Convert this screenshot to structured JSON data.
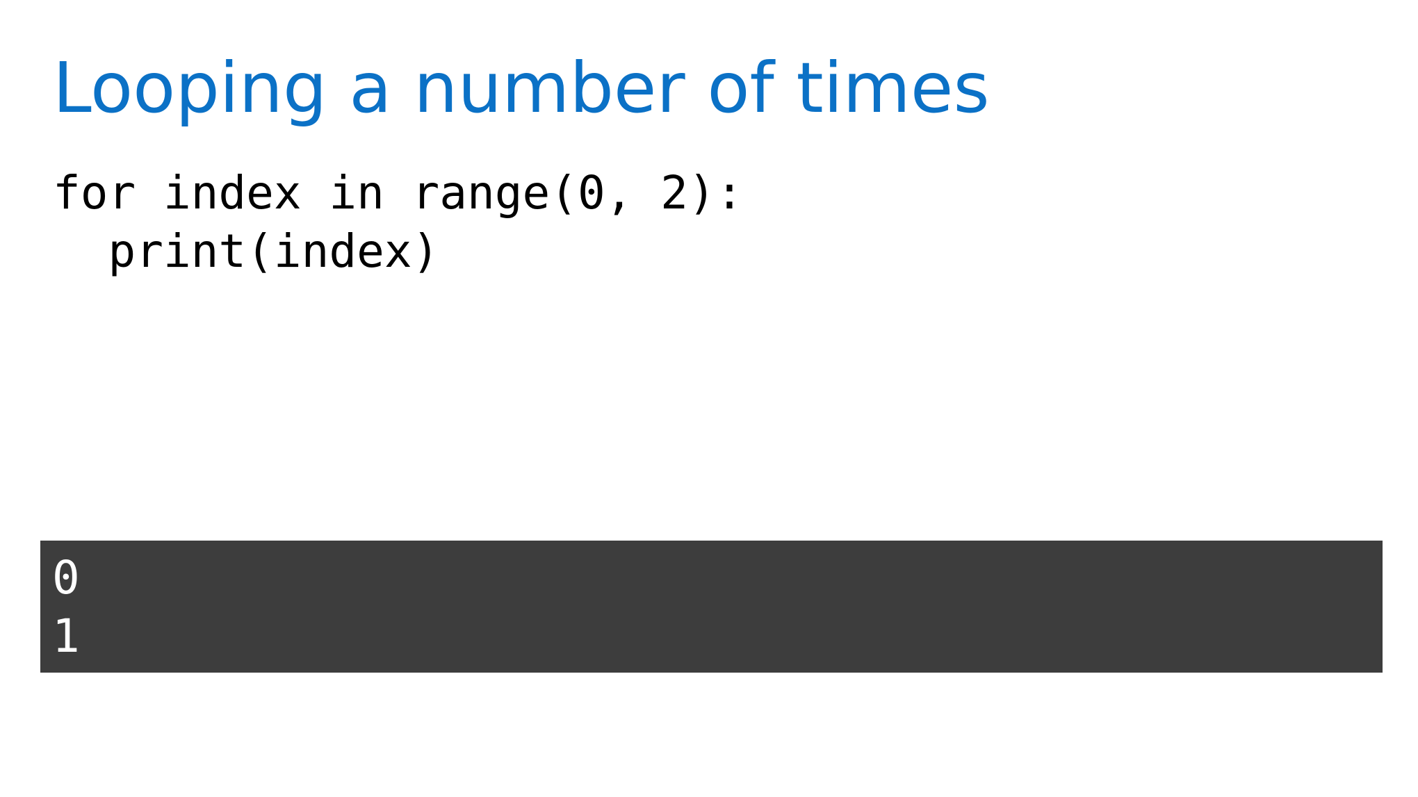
{
  "slide": {
    "title": "Looping a number of times",
    "title_color": "#0b71c6",
    "code_lines": [
      "for index in range(0, 2):",
      "  print(index)"
    ],
    "output_background": "#3d3d3d",
    "output_lines": [
      "0",
      "1"
    ]
  }
}
